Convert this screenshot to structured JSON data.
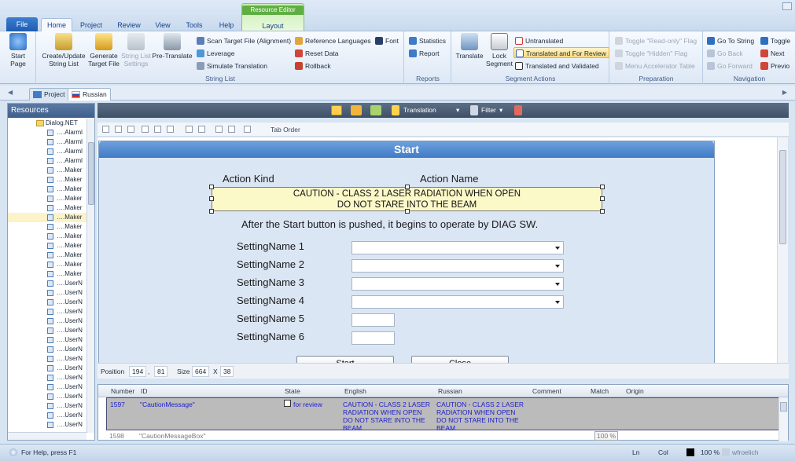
{
  "ribbon_tabs": {
    "file": "File",
    "home": "Home",
    "project": "Project",
    "review": "Review",
    "view": "View",
    "tools": "Tools",
    "help": "Help",
    "layout": "Layout",
    "context_group": "Resource Editor"
  },
  "start_group": {
    "start_page": "Start Page"
  },
  "string_list": {
    "label": "String List",
    "create_update": "Create/Update String List",
    "generate_target": "Generate Target File",
    "string_list_settings": "String List Settings",
    "pre_translate": "Pre-Translate",
    "scan_target": "Scan Target File (Alignment)",
    "leverage": "Leverage",
    "simulate": "Simulate Translation",
    "reference_languages": "Reference Languages",
    "reset_data": "Reset Data",
    "rollback": "Rollback",
    "font": "Font"
  },
  "reports": {
    "label": "Reports",
    "statistics": "Statistics",
    "report": "Report"
  },
  "segment_actions": {
    "label": "Segment Actions",
    "translate": "Translate",
    "lock_segment": "Lock Segment",
    "untranslated": "Untranslated",
    "translated_for_review": "Translated and For Review",
    "translated_validated": "Translated and Validated"
  },
  "preparation": {
    "label": "Preparation",
    "toggle_readonly": "Toggle \"Read-only\" Flag",
    "toggle_hidden": "Toggle \"Hidden\" Flag",
    "menu_accelerator": "Menu Accelerator Table"
  },
  "navigation": {
    "label": "Navigation",
    "go_to_string": "Go To String",
    "go_back": "Go Back",
    "go_forward": "Go Forward",
    "toggle": "Toggle",
    "next": "Next",
    "previous": "Previo"
  },
  "doc_tabs": {
    "project": "Project",
    "russian": "Russian"
  },
  "resources": {
    "title": "Resources",
    "root": "Dialog.NET",
    "items": [
      "….Alarml",
      "….Alarml",
      "….Alarml",
      "….Alarml",
      "….Maker",
      "….Maker",
      "….Maker",
      "….Maker",
      "….Maker",
      "….Maker",
      "….Maker",
      "….Maker",
      "….Maker",
      "….Maker",
      "….Maker",
      "….Maker",
      "….UserN",
      "….UserN",
      "….UserN",
      "….UserN",
      "….UserN",
      "….UserN",
      "….UserN",
      "….UserN",
      "….UserN",
      "….UserN",
      "….UserN",
      "….UserN",
      "….UserN",
      "….UserN",
      "….UserN",
      "….UserN"
    ]
  },
  "editor_toolbar": {
    "translation": "Translation",
    "filter": "Filter"
  },
  "align_bar": {
    "tab_order": "Tab Order"
  },
  "dialog": {
    "title": "Start",
    "action_kind": "Action Kind",
    "action_name": "Action Name",
    "caution_line1": "CAUTION - CLASS 2 LASER RADIATION WHEN OPEN",
    "caution_line2": "DO NOT STARE INTO THE BEAM",
    "instruction": "After the Start button is pushed, it begins to operate by DIAG SW.",
    "settings": [
      "SettingName 1",
      "SettingName 2",
      "SettingName 3",
      "SettingName 4",
      "SettingName 5",
      "SettingName 6"
    ],
    "button_start": "Start",
    "button_close": "Close"
  },
  "position_bar": {
    "position_label": "Position",
    "pos_x": "194",
    "pos_y": "81",
    "size_label": "Size",
    "width": "664",
    "x": "X",
    "height": "38"
  },
  "grid": {
    "headers": {
      "number": "Number",
      "id": "ID",
      "state": "State",
      "english": "English",
      "russian": "Russian",
      "comment": "Comment",
      "match": "Match",
      "origin": "Origin"
    },
    "rows": [
      {
        "number": "1597",
        "id": "\"CautionMessage\"",
        "state": "for review",
        "english": "CAUTION - CLASS 2 LASER RADIATION WHEN OPEN DO NOT STARE INTO THE BEAM",
        "russian": "CAUTION - CLASS 2 LASER RADIATION WHEN OPEN DO NOT STARE INTO THE BEAM"
      },
      {
        "number": "1598",
        "id": "\"CautionMessageBox\"",
        "match": "100 %"
      }
    ]
  },
  "status": {
    "help": "For Help, press F1",
    "ln": "Ln",
    "col": "Col",
    "zoom": "100 %",
    "user": "wfroelich"
  }
}
